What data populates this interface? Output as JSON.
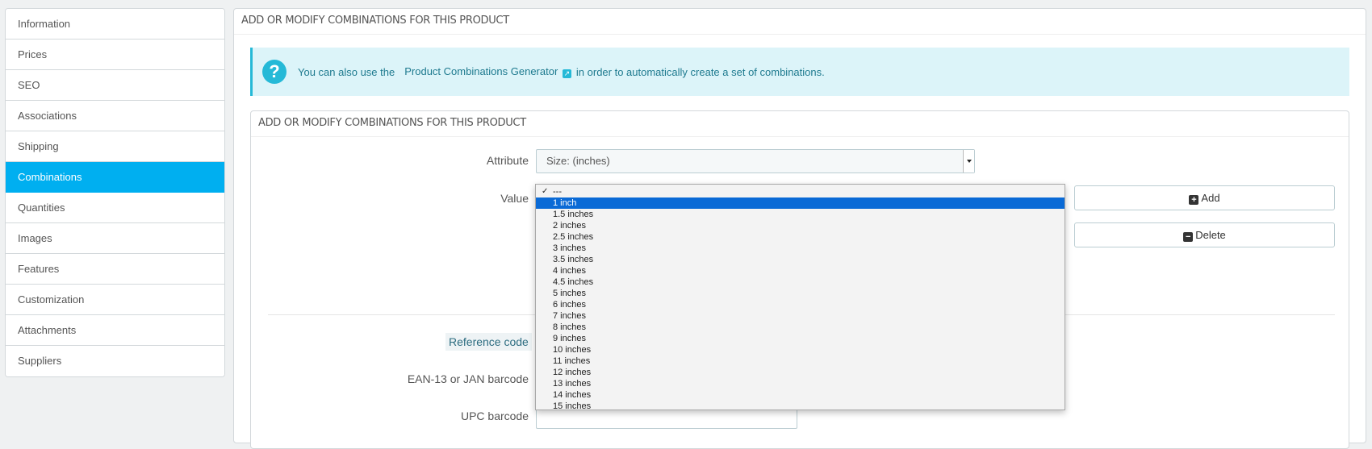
{
  "sidebar": {
    "items": [
      {
        "label": "Information"
      },
      {
        "label": "Prices"
      },
      {
        "label": "SEO"
      },
      {
        "label": "Associations"
      },
      {
        "label": "Shipping"
      },
      {
        "label": "Combinations",
        "active": true
      },
      {
        "label": "Quantities"
      },
      {
        "label": "Images"
      },
      {
        "label": "Features"
      },
      {
        "label": "Customization"
      },
      {
        "label": "Attachments"
      },
      {
        "label": "Suppliers"
      }
    ]
  },
  "panel": {
    "heading": "ADD OR MODIFY COMBINATIONS FOR THIS PRODUCT",
    "alert": {
      "prefix": "You can also use the",
      "link": "Product Combinations Generator",
      "suffix": "in order to automatically create a set of combinations."
    },
    "sub_heading": "ADD OR MODIFY COMBINATIONS FOR THIS PRODUCT"
  },
  "form": {
    "attribute_label": "Attribute",
    "attribute_value": "Size: (inches)",
    "value_label": "Value",
    "add_label": "Add",
    "delete_label": "Delete",
    "reference_label": "Reference code",
    "ean_label": "EAN-13 or JAN barcode",
    "upc_label": "UPC barcode"
  },
  "dropdown": {
    "selected": "---",
    "highlighted": "1 inch",
    "options": [
      "---",
      "1 inch",
      "1.5 inches",
      "2 inches",
      "2.5 inches",
      "3 inches",
      "3.5 inches",
      "4 inches",
      "4.5 inches",
      "5 inches",
      "6 inches",
      "7 inches",
      "8 inches",
      "9 inches",
      "10 inches",
      "11 inches",
      "12 inches",
      "13 inches",
      "14 inches",
      "15 inches"
    ]
  },
  "colors": {
    "accent": "#00aff0",
    "alert_bg": "#dcf4f9",
    "highlight": "#0a6ad6"
  }
}
